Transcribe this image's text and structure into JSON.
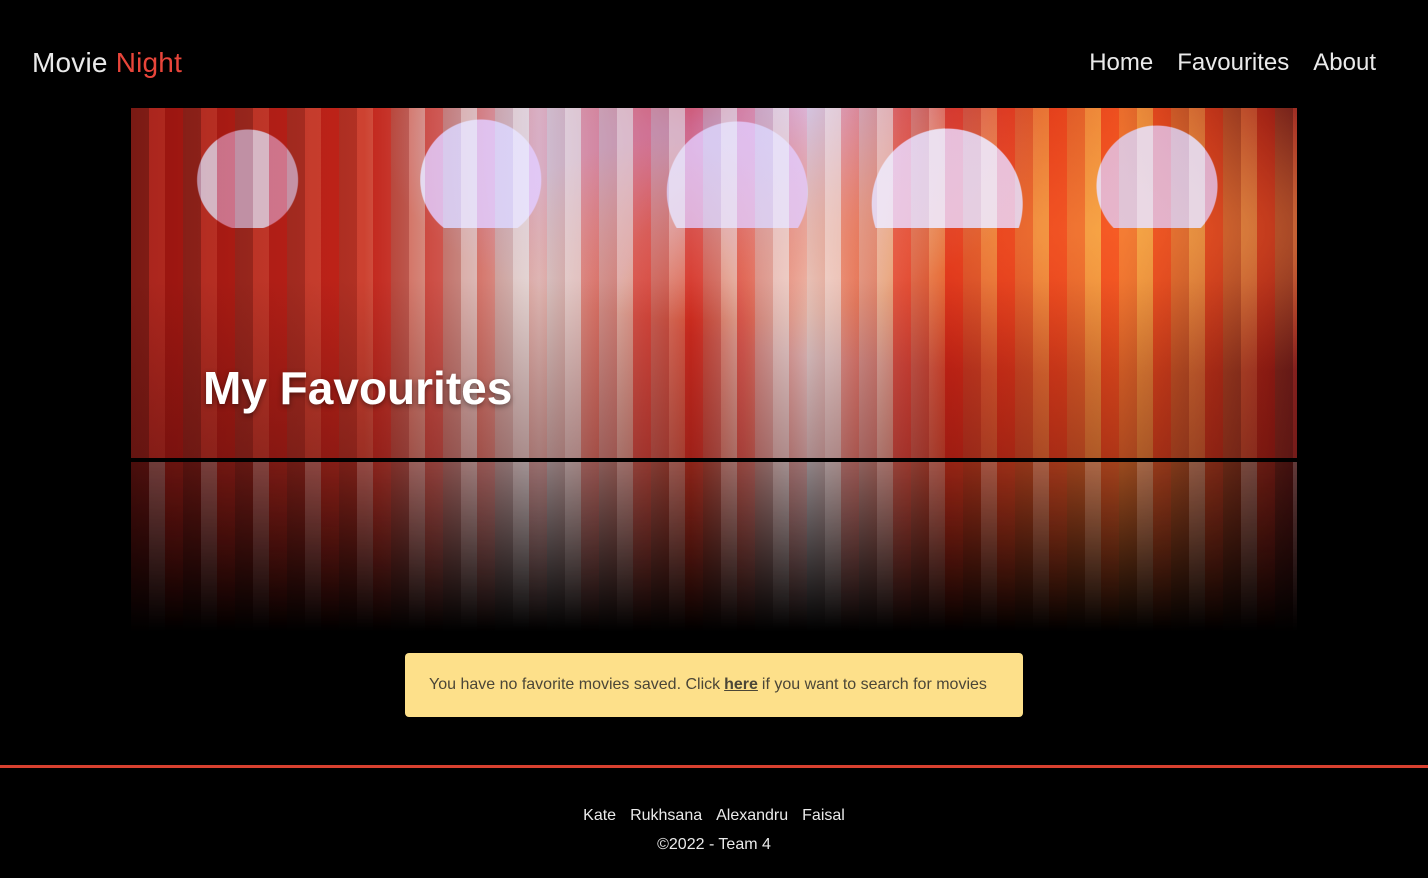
{
  "brand": {
    "word1": "Movie",
    "word2": "Night"
  },
  "nav": {
    "home": "Home",
    "favourites": "Favourites",
    "about": "About"
  },
  "hero": {
    "title": "My Favourites"
  },
  "alert": {
    "text_before": "You have no favorite movies saved. Click",
    "link": "here",
    "text_after": "if you want to search for movies"
  },
  "footer": {
    "names": [
      "Kate",
      "Rukhsana",
      "Alexandru",
      "Faisal"
    ],
    "copyright": "©2022 - Team 4"
  },
  "colors": {
    "accent": "#e8453a",
    "background": "#000000",
    "alert_bg": "#fde08a",
    "footer_rule": "#d8402f"
  }
}
